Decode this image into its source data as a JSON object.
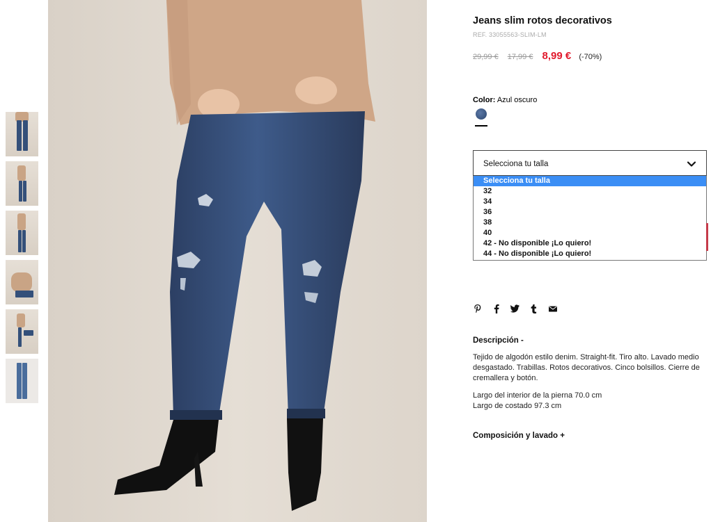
{
  "product": {
    "title": "Jeans slim rotos decorativos",
    "ref": "REF. 33055563-SLIM-LM",
    "price_original": "29,99 €",
    "price_previous": "17,99 €",
    "price_current": "8,99 €",
    "discount": "(-70%)"
  },
  "color": {
    "label": "Color:",
    "value": "Azul oscuro",
    "swatch_hex": "#3a557f"
  },
  "size_select": {
    "selected": "Selecciona tu talla",
    "options": [
      "Selecciona tu talla",
      "32",
      "34",
      "36",
      "38",
      "40",
      "42 - No disponible ¡Lo quiero!",
      "44 - No disponible ¡Lo quiero!"
    ]
  },
  "social": [
    "pinterest-icon",
    "facebook-icon",
    "twitter-icon",
    "tumblr-icon",
    "email-icon"
  ],
  "description": {
    "heading": "Descripción -",
    "paragraph1": "Tejido de algodón estilo denim. Straight-fit. Tiro alto. Lavado medio desgastado. Trabillas. Rotos decorativos. Cinco bolsillos. Cierre de cremallera y botón.",
    "paragraph2_line1": "Largo del interior de la pierna 70.0 cm",
    "paragraph2_line2": "Largo de costado 97.3 cm"
  },
  "composition": {
    "heading": "Composición y lavado +"
  },
  "colors": {
    "sale_red": "#e1192c",
    "highlight_blue": "#3b8ef5",
    "denim": "#34507a"
  }
}
